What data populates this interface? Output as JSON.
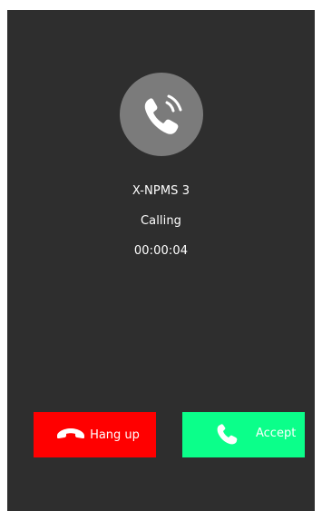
{
  "call": {
    "caller_name": "X-NPMS 3",
    "status": "Calling",
    "timer": "00:00:04"
  },
  "buttons": {
    "hangup_label": "Hang up",
    "accept_label": "Accept"
  },
  "icons": {
    "avatar": "phone-ringing-icon",
    "hangup": "phone-down-icon",
    "accept": "phone-icon"
  },
  "colors": {
    "background": "#2e2e2e",
    "avatar_circle": "#7b7b7b",
    "hangup": "#ff0000",
    "accept": "#0bff8a"
  }
}
